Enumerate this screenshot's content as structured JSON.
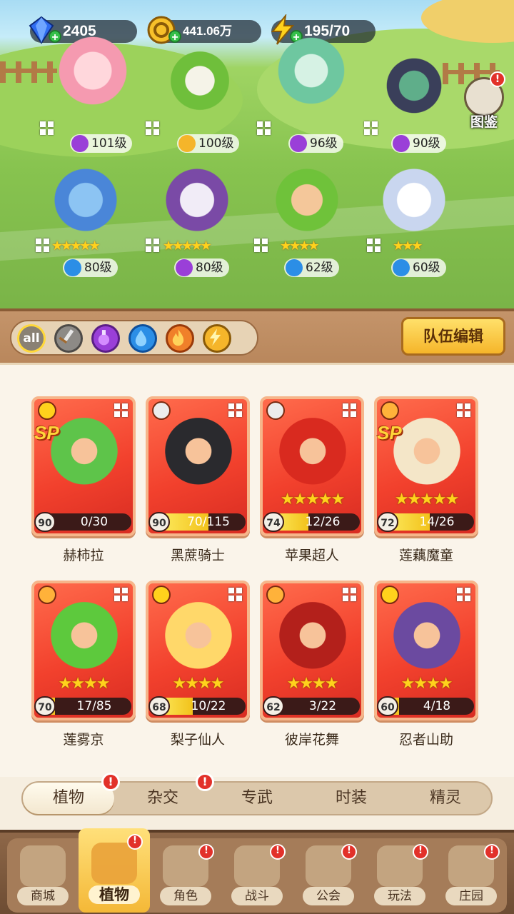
{
  "resources": {
    "gems": "2405",
    "coins": "441.06万",
    "energy": "195/70"
  },
  "atlas_label": "图鉴",
  "field_heroes": [
    {
      "level": "101级",
      "element": "potion",
      "stars": ""
    },
    {
      "level": "100级",
      "element": "lightning",
      "stars": ""
    },
    {
      "level": "96级",
      "element": "potion",
      "stars": ""
    },
    {
      "level": "90级",
      "element": "potion",
      "stars": ""
    },
    {
      "level": "80级",
      "element": "water",
      "stars": "★★★★★"
    },
    {
      "level": "80级",
      "element": "potion",
      "stars": "★★★★★"
    },
    {
      "level": "62级",
      "element": "water",
      "stars": "★★★★"
    },
    {
      "level": "60级",
      "element": "water",
      "stars": "★★★"
    }
  ],
  "filters": {
    "all_label": "all",
    "icons": [
      "all-filter",
      "sword-icon",
      "potion-icon",
      "water-drop-icon",
      "fire-icon",
      "lightning-icon"
    ]
  },
  "team_edit_label": "队伍编辑",
  "cards": [
    {
      "name": "赫柿拉",
      "level": "90",
      "progress": "0/30",
      "fill": 0.0,
      "stars": "",
      "element": "lightning",
      "sp": "SP"
    },
    {
      "name": "黑蔗骑士",
      "level": "90",
      "progress": "70/115",
      "fill": 0.61,
      "stars": "",
      "element": "sword",
      "sp": ""
    },
    {
      "name": "苹果超人",
      "level": "74",
      "progress": "12/26",
      "fill": 0.46,
      "stars": "★★★★★",
      "element": "sword",
      "sp": ""
    },
    {
      "name": "莲藕魔童",
      "level": "72",
      "progress": "14/26",
      "fill": 0.54,
      "stars": "★★★★★",
      "element": "fire",
      "sp": "SP"
    },
    {
      "name": "莲雾京",
      "level": "70",
      "progress": "17/85",
      "fill": 0.2,
      "stars": "★★★★",
      "element": "fire",
      "sp": ""
    },
    {
      "name": "梨子仙人",
      "level": "68",
      "progress": "10/22",
      "fill": 0.45,
      "stars": "★★★★",
      "element": "lightning",
      "sp": ""
    },
    {
      "name": "彼岸花舞",
      "level": "62",
      "progress": "3/22",
      "fill": 0.14,
      "stars": "★★★★",
      "element": "fire",
      "sp": ""
    },
    {
      "name": "忍者山助",
      "level": "60",
      "progress": "4/18",
      "fill": 0.22,
      "stars": "★★★★",
      "element": "lightning",
      "sp": ""
    }
  ],
  "categories": [
    {
      "label": "植物",
      "active": true,
      "alert": "!"
    },
    {
      "label": "杂交",
      "active": false,
      "alert": "!"
    },
    {
      "label": "专武",
      "active": false,
      "alert": ""
    },
    {
      "label": "时装",
      "active": false,
      "alert": ""
    },
    {
      "label": "精灵",
      "active": false,
      "alert": ""
    }
  ],
  "nav": [
    {
      "label": "商城",
      "active": false,
      "alert": ""
    },
    {
      "label": "植物",
      "active": true,
      "alert": "!"
    },
    {
      "label": "角色",
      "active": false,
      "alert": "!"
    },
    {
      "label": "战斗",
      "active": false,
      "alert": "!"
    },
    {
      "label": "公会",
      "active": false,
      "alert": "!"
    },
    {
      "label": "玩法",
      "active": false,
      "alert": "!"
    },
    {
      "label": "庄园",
      "active": false,
      "alert": "!"
    }
  ],
  "colors": {
    "card_red": "#f2412d",
    "accent_gold": "#f5b52a",
    "alert_red": "#e2312a"
  }
}
